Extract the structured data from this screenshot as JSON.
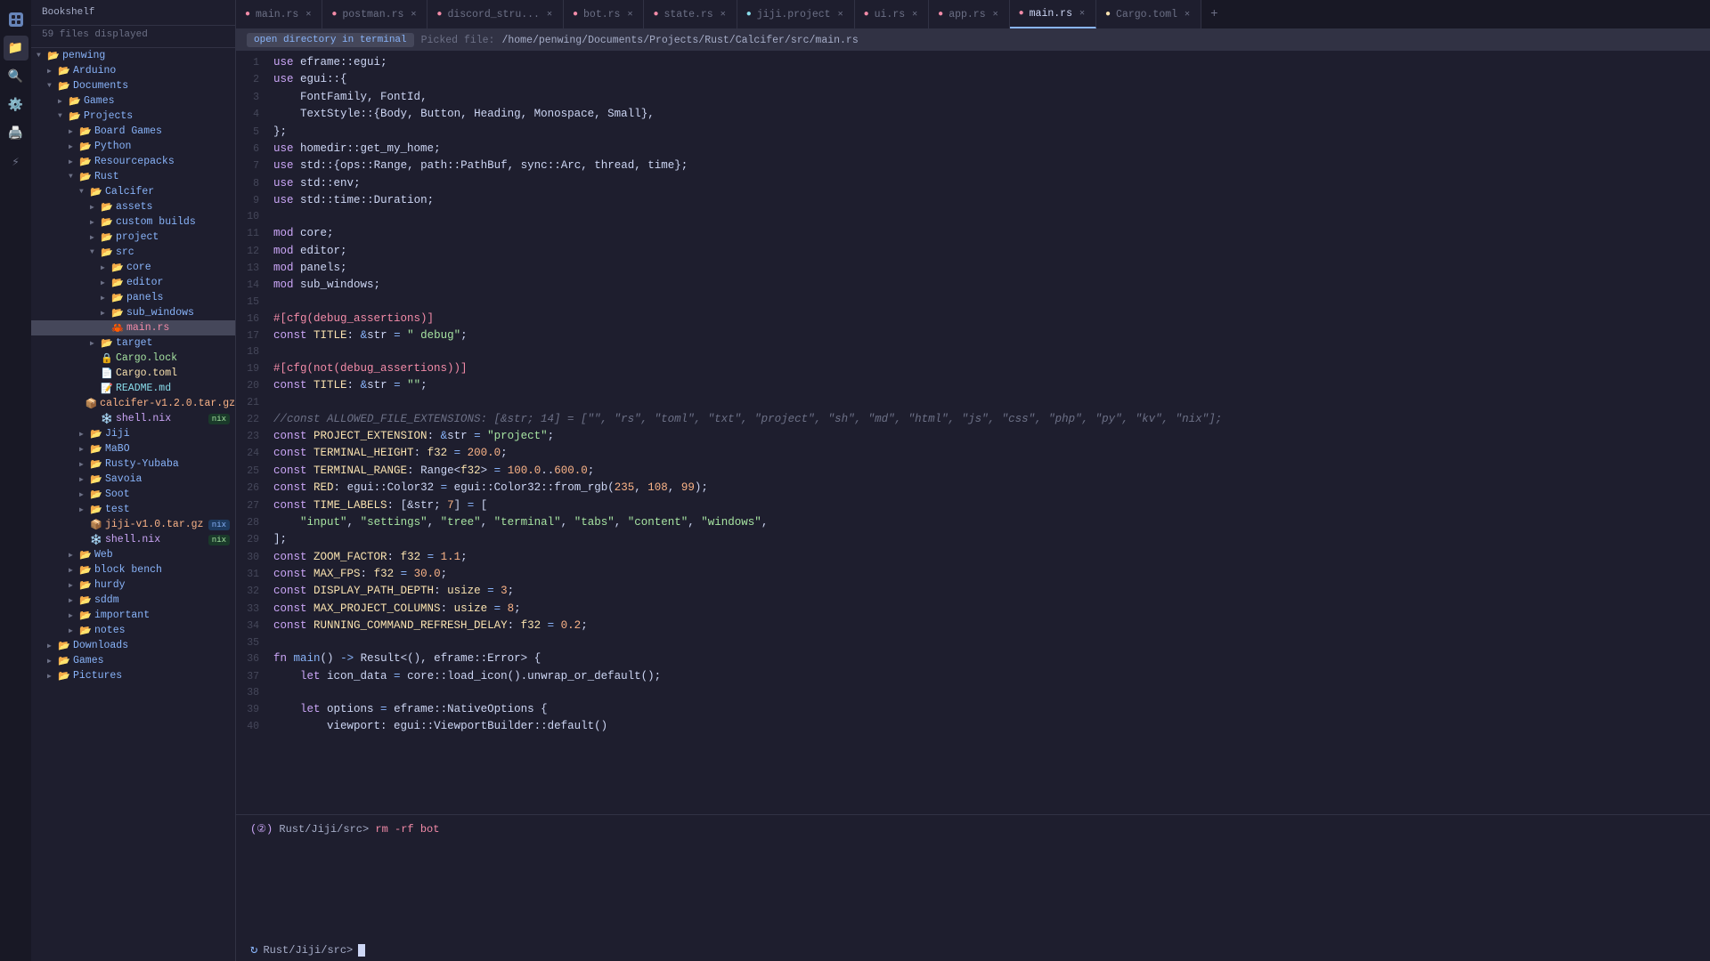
{
  "app": {
    "title": "Bookshelf",
    "files_displayed": "59 files displayed"
  },
  "tabs": [
    {
      "id": "main-rs-1",
      "label": "main.rs",
      "type": "rs",
      "active": false,
      "closable": true
    },
    {
      "id": "postman-rs",
      "label": "postman.rs",
      "type": "rs",
      "active": false,
      "closable": true
    },
    {
      "id": "discord-stru",
      "label": "discord_stru...",
      "type": "rs",
      "active": false,
      "closable": true
    },
    {
      "id": "bot-rs",
      "label": "bot.rs",
      "type": "rs",
      "active": false,
      "closable": true
    },
    {
      "id": "state-rs",
      "label": "state.rs",
      "type": "rs",
      "active": false,
      "closable": true
    },
    {
      "id": "jiji-project",
      "label": "jiji.project",
      "type": "project",
      "active": false,
      "closable": true
    },
    {
      "id": "ui-rs",
      "label": "ui.rs",
      "type": "rs",
      "active": false,
      "closable": true
    },
    {
      "id": "app-rs",
      "label": "app.rs",
      "type": "rs",
      "active": false,
      "closable": true
    },
    {
      "id": "main-rs-2",
      "label": "main.rs",
      "type": "rs",
      "active": true,
      "closable": true
    },
    {
      "id": "cargo-toml",
      "label": "Cargo.toml",
      "type": "toml",
      "active": false,
      "closable": true
    }
  ],
  "info_bar": {
    "btn_label": "open directory in terminal",
    "picked_file_label": "Picked file:",
    "path": "/home/penwing/Documents/Projects/Rust/Calcifer/src/main.rs"
  },
  "code_lines": [
    {
      "n": 1,
      "html": "<span class='kw'>use</span> eframe<span class='punct'>::</span>egui<span class='punct'>;</span>"
    },
    {
      "n": 2,
      "html": "<span class='kw'>use</span> egui<span class='punct'>::{</span>"
    },
    {
      "n": 3,
      "html": "    FontFamily<span class='punct'>,</span> FontId<span class='punct'>,</span>"
    },
    {
      "n": 4,
      "html": "    TextStyle<span class='punct'>::{</span>Body<span class='punct'>,</span> Button<span class='punct'>,</span> Heading<span class='punct'>,</span> Monospace<span class='punct'>,</span> Small<span class='punct'>},</span>"
    },
    {
      "n": 5,
      "html": "<span class='punct'>};</span>"
    },
    {
      "n": 6,
      "html": "<span class='kw'>use</span> homedir<span class='punct'>::</span>get_my_home<span class='punct'>;</span>"
    },
    {
      "n": 7,
      "html": "<span class='kw'>use</span> std<span class='punct'>::{</span>ops<span class='punct'>::</span>Range<span class='punct'>,</span> path<span class='punct'>::</span>PathBuf<span class='punct'>,</span> sync<span class='punct'>::</span>Arc<span class='punct'>,</span> thread<span class='punct'>,</span> time<span class='punct'>};</span>"
    },
    {
      "n": 8,
      "html": "<span class='kw'>use</span> std<span class='punct'>::</span>env<span class='punct'>;</span>"
    },
    {
      "n": 9,
      "html": "<span class='kw'>use</span> std<span class='punct'>::</span>time<span class='punct'>::</span>Duration<span class='punct'>;</span>"
    },
    {
      "n": 10,
      "html": ""
    },
    {
      "n": 11,
      "html": "<span class='kw'>mod</span> core<span class='punct'>;</span>"
    },
    {
      "n": 12,
      "html": "<span class='kw'>mod</span> editor<span class='punct'>;</span>"
    },
    {
      "n": 13,
      "html": "<span class='kw'>mod</span> panels<span class='punct'>;</span>"
    },
    {
      "n": 14,
      "html": "<span class='kw'>mod</span> sub_windows<span class='punct'>;</span>"
    },
    {
      "n": 15,
      "html": ""
    },
    {
      "n": 16,
      "html": "<span class='attr'>#[cfg(debug_assertions)]</span>"
    },
    {
      "n": 17,
      "html": "<span class='kw'>const</span> <span class='const-name'>TITLE</span><span class='punct'>:</span> <span class='op'>&amp;</span>str <span class='op'>=</span> <span class='str'>\" debug\"</span><span class='punct'>;</span>"
    },
    {
      "n": 18,
      "html": ""
    },
    {
      "n": 19,
      "html": "<span class='attr'>#[cfg(not(debug_assertions))]</span>"
    },
    {
      "n": 20,
      "html": "<span class='kw'>const</span> <span class='const-name'>TITLE</span><span class='punct'>:</span> <span class='op'>&amp;</span>str <span class='op'>=</span> <span class='str'>\"\"</span><span class='punct'>;</span>"
    },
    {
      "n": 21,
      "html": ""
    },
    {
      "n": 22,
      "html": "<span class='cm'>//const ALLOWED_FILE_EXTENSIONS: [&amp;str; 14] = [\"\", \"rs\", \"toml\", \"txt\", \"project\", \"sh\", \"md\", \"html\", \"js\", \"css\", \"php\", \"py\", \"kv\", \"nix\"];</span>"
    },
    {
      "n": 23,
      "html": "<span class='kw'>const</span> <span class='const-name'>PROJECT_EXTENSION</span><span class='punct'>:</span> <span class='op'>&amp;</span>str <span class='op'>=</span> <span class='str'>\"project\"</span><span class='punct'>;</span>"
    },
    {
      "n": 24,
      "html": "<span class='kw'>const</span> <span class='const-name'>TERMINAL_HEIGHT</span><span class='punct'>:</span> <span class='ty'>f32</span> <span class='op'>=</span> <span class='num'>200.0</span><span class='punct'>;</span>"
    },
    {
      "n": 25,
      "html": "<span class='kw'>const</span> <span class='const-name'>TERMINAL_RANGE</span><span class='punct'>:</span> Range<span class='punct'>&lt;</span><span class='ty'>f32</span><span class='punct'>&gt;</span> <span class='op'>=</span> <span class='num'>100.0</span><span class='punct'>..</span><span class='num'>600.0</span><span class='punct'>;</span>"
    },
    {
      "n": 26,
      "html": "<span class='kw'>const</span> <span class='const-name'>RED</span><span class='punct'>:</span> egui<span class='punct'>::</span>Color32 <span class='op'>=</span> egui<span class='punct'>::</span>Color32<span class='punct'>::</span>from_rgb<span class='punct'>(</span><span class='num'>235</span><span class='punct'>,</span> <span class='num'>108</span><span class='punct'>,</span> <span class='num'>99</span><span class='punct'>);</span>"
    },
    {
      "n": 27,
      "html": "<span class='kw'>const</span> <span class='const-name'>TIME_LABELS</span><span class='punct'>:</span> <span class='punct'>[&amp;</span>str<span class='punct'>;</span> <span class='num'>7</span><span class='punct'>]</span> <span class='op'>=</span> <span class='punct'>[</span>"
    },
    {
      "n": 28,
      "html": "    <span class='str'>\"input\"</span><span class='punct'>,</span> <span class='str'>\"settings\"</span><span class='punct'>,</span> <span class='str'>\"tree\"</span><span class='punct'>,</span> <span class='str'>\"terminal\"</span><span class='punct'>,</span> <span class='str'>\"tabs\"</span><span class='punct'>,</span> <span class='str'>\"content\"</span><span class='punct'>,</span> <span class='str'>\"windows\"</span><span class='punct'>,</span>"
    },
    {
      "n": 29,
      "html": "<span class='punct'>];</span>"
    },
    {
      "n": 30,
      "html": "<span class='kw'>const</span> <span class='const-name'>ZOOM_FACTOR</span><span class='punct'>:</span> <span class='ty'>f32</span> <span class='op'>=</span> <span class='num'>1.1</span><span class='punct'>;</span>"
    },
    {
      "n": 31,
      "html": "<span class='kw'>const</span> <span class='const-name'>MAX_FPS</span><span class='punct'>:</span> <span class='ty'>f32</span> <span class='op'>=</span> <span class='num'>30.0</span><span class='punct'>;</span>"
    },
    {
      "n": 32,
      "html": "<span class='kw'>const</span> <span class='const-name'>DISPLAY_PATH_DEPTH</span><span class='punct'>:</span> <span class='ty'>usize</span> <span class='op'>=</span> <span class='num'>3</span><span class='punct'>;</span>"
    },
    {
      "n": 33,
      "html": "<span class='kw'>const</span> <span class='const-name'>MAX_PROJECT_COLUMNS</span><span class='punct'>:</span> <span class='ty'>usize</span> <span class='op'>=</span> <span class='num'>8</span><span class='punct'>;</span>"
    },
    {
      "n": 34,
      "html": "<span class='kw'>const</span> <span class='const-name'>RUNNING_COMMAND_REFRESH_DELAY</span><span class='punct'>:</span> <span class='ty'>f32</span> <span class='op'>=</span> <span class='num'>0.2</span><span class='punct'>;</span>"
    },
    {
      "n": 35,
      "html": ""
    },
    {
      "n": 36,
      "html": "<span class='kw'>fn</span> <span class='fn'>main</span><span class='punct'>()</span> <span class='op'>-&gt;</span> Result<span class='punct'>&lt;(),</span> eframe<span class='punct'>::</span>Error<span class='punct'>&gt;</span> <span class='punct'>{</span>"
    },
    {
      "n": 37,
      "html": "    <span class='kw'>let</span> icon_data <span class='op'>=</span> core<span class='punct'>::</span>load_icon<span class='punct'>().</span>unwrap_or_default<span class='punct'>();</span>"
    },
    {
      "n": 38,
      "html": ""
    },
    {
      "n": 39,
      "html": "    <span class='kw'>let</span> options <span class='op'>=</span> eframe<span class='punct'>::</span>NativeOptions <span class='punct'>{</span>"
    },
    {
      "n": 40,
      "html": "        viewport<span class='punct'>:</span> egui<span class='punct'>::</span>ViewportBuilder<span class='punct'>::</span>default<span class='punct'>()"
    }
  ],
  "terminal": {
    "cmd_line": "(②) Rust/Jiji/src> rm -rf bot",
    "prompt_path": "Rust/Jiji/src>",
    "cmd_num": "②",
    "cmd": "rm -rf bot"
  },
  "file_tree": {
    "root_label": "penwing",
    "items": [
      {
        "label": "penwing",
        "depth": 0,
        "type": "folder",
        "expanded": true,
        "arrow": "▼"
      },
      {
        "label": "Arduino",
        "depth": 1,
        "type": "folder",
        "expanded": false,
        "arrow": "▶"
      },
      {
        "label": "Documents",
        "depth": 1,
        "type": "folder",
        "expanded": true,
        "arrow": "▼"
      },
      {
        "label": "Games",
        "depth": 2,
        "type": "folder",
        "expanded": false,
        "arrow": "▶"
      },
      {
        "label": "Projects",
        "depth": 2,
        "type": "folder",
        "expanded": true,
        "arrow": "▼"
      },
      {
        "label": "Board Games",
        "depth": 3,
        "type": "folder",
        "expanded": false,
        "arrow": "▶"
      },
      {
        "label": "Python",
        "depth": 3,
        "type": "folder",
        "expanded": false,
        "arrow": "▶"
      },
      {
        "label": "Resourcepacks",
        "depth": 3,
        "type": "folder",
        "expanded": false,
        "arrow": "▶"
      },
      {
        "label": "Rust",
        "depth": 3,
        "type": "folder",
        "expanded": true,
        "arrow": "▼"
      },
      {
        "label": "Calcifer",
        "depth": 4,
        "type": "folder",
        "expanded": true,
        "arrow": "▼"
      },
      {
        "label": "assets",
        "depth": 5,
        "type": "folder",
        "expanded": false,
        "arrow": "▶"
      },
      {
        "label": "custom builds",
        "depth": 5,
        "type": "folder",
        "expanded": false,
        "arrow": "▶"
      },
      {
        "label": "project",
        "depth": 5,
        "type": "folder",
        "expanded": false,
        "arrow": "▶"
      },
      {
        "label": "src",
        "depth": 5,
        "type": "folder",
        "expanded": true,
        "arrow": "▼"
      },
      {
        "label": "core",
        "depth": 6,
        "type": "folder",
        "expanded": false,
        "arrow": "▶"
      },
      {
        "label": "editor",
        "depth": 6,
        "type": "folder",
        "expanded": false,
        "arrow": "▶"
      },
      {
        "label": "panels",
        "depth": 6,
        "type": "folder",
        "expanded": false,
        "arrow": "▶"
      },
      {
        "label": "sub_windows",
        "depth": 6,
        "type": "folder",
        "expanded": false,
        "arrow": "▶"
      },
      {
        "label": "main.rs",
        "depth": 6,
        "type": "rs",
        "selected": true
      },
      {
        "label": "target",
        "depth": 5,
        "type": "folder",
        "expanded": false,
        "arrow": "▶"
      },
      {
        "label": "Cargo.lock",
        "depth": 5,
        "type": "lock",
        "badge": ""
      },
      {
        "label": "Cargo.toml",
        "depth": 5,
        "type": "toml"
      },
      {
        "label": "README.md",
        "depth": 5,
        "type": "md"
      },
      {
        "label": "calcifer-v1.2.0.tar.gz",
        "depth": 5,
        "type": "tar"
      },
      {
        "label": "shell.nix",
        "depth": 5,
        "type": "nix",
        "badge": "green"
      },
      {
        "label": "Jiji",
        "depth": 4,
        "type": "folder",
        "expanded": false,
        "arrow": "▶"
      },
      {
        "label": "MaBO",
        "depth": 4,
        "type": "folder",
        "expanded": false,
        "arrow": "▶"
      },
      {
        "label": "Rusty-Yubaba",
        "depth": 4,
        "type": "folder",
        "expanded": false,
        "arrow": "▶"
      },
      {
        "label": "Savoia",
        "depth": 4,
        "type": "folder",
        "expanded": false,
        "arrow": "▶"
      },
      {
        "label": "Soot",
        "depth": 4,
        "type": "folder",
        "expanded": false,
        "arrow": "▶"
      },
      {
        "label": "test",
        "depth": 4,
        "type": "folder",
        "expanded": false,
        "arrow": "▶"
      },
      {
        "label": "jiji-v1.0.tar.gz",
        "depth": 4,
        "type": "tar",
        "badge": "blue"
      },
      {
        "label": "shell.nix",
        "depth": 4,
        "type": "nix",
        "badge": "green"
      },
      {
        "label": "Web",
        "depth": 3,
        "type": "folder",
        "expanded": false,
        "arrow": "▶"
      },
      {
        "label": "block bench",
        "depth": 3,
        "type": "folder",
        "expanded": false,
        "arrow": "▶"
      },
      {
        "label": "hurdy",
        "depth": 3,
        "type": "folder",
        "expanded": false,
        "arrow": "▶"
      },
      {
        "label": "sddm",
        "depth": 3,
        "type": "folder",
        "expanded": false,
        "arrow": "▶"
      },
      {
        "label": "important",
        "depth": 3,
        "type": "folder",
        "expanded": false,
        "arrow": "▶"
      },
      {
        "label": "notes",
        "depth": 3,
        "type": "folder",
        "expanded": false,
        "arrow": "▶"
      },
      {
        "label": "Downloads",
        "depth": 1,
        "type": "folder",
        "expanded": false,
        "arrow": "▶"
      },
      {
        "label": "Games",
        "depth": 1,
        "type": "folder",
        "expanded": false,
        "arrow": "▶"
      },
      {
        "label": "Pictures",
        "depth": 1,
        "type": "folder",
        "expanded": false,
        "arrow": "▶"
      }
    ]
  },
  "bookshelf_title": "Bookshelf"
}
